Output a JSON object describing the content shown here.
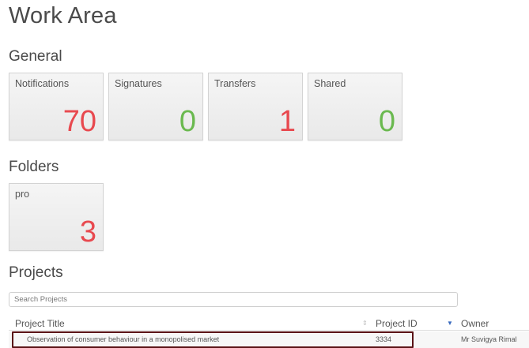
{
  "page_title": "Work Area",
  "general": {
    "title": "General",
    "tiles": [
      {
        "label": "Notifications",
        "count": "70",
        "color": "#e8494f"
      },
      {
        "label": "Signatures",
        "count": "0",
        "color": "#6ab94f"
      },
      {
        "label": "Transfers",
        "count": "1",
        "color": "#e8494f"
      },
      {
        "label": "Shared",
        "count": "0",
        "color": "#6ab94f"
      }
    ]
  },
  "folders": {
    "title": "Folders",
    "tiles": [
      {
        "label": "pro",
        "count": "3",
        "color": "#e8494f"
      }
    ]
  },
  "projects": {
    "title": "Projects",
    "search_placeholder": "Search Projects",
    "columns": {
      "title": "Project Title",
      "id": "Project ID",
      "owner": "Owner"
    },
    "rows": [
      {
        "title": "Observation of consumer behaviour in a monopolised market",
        "id": "3334",
        "owner": "Mr Suvigya Rimal"
      }
    ],
    "highlight_color": "#5a1316"
  }
}
